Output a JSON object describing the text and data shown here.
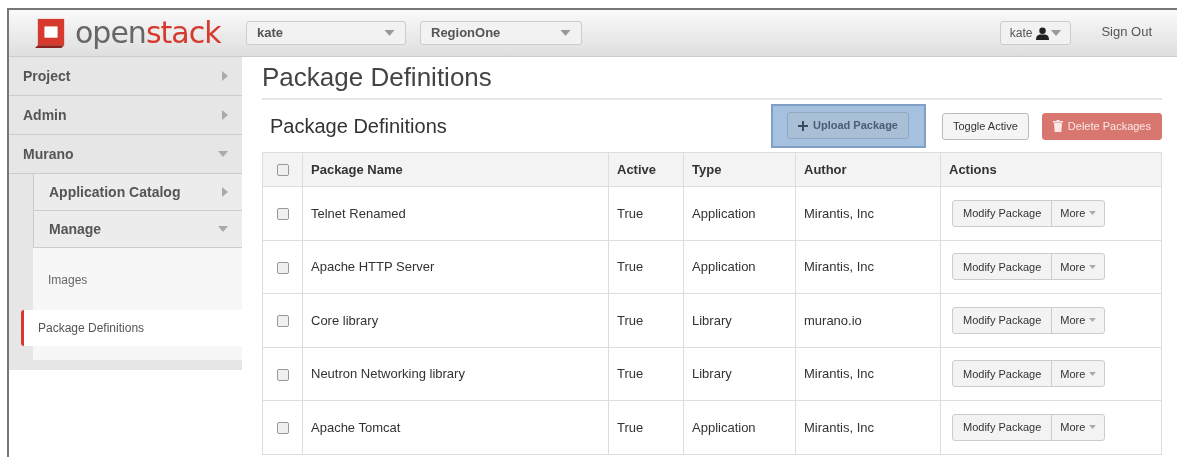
{
  "header": {
    "logo": {
      "prefix": "open",
      "suffix": "stack"
    },
    "project_select": "kate",
    "region_select": "RegionOne",
    "user_menu": "kate",
    "sign_out": "Sign Out"
  },
  "sidebar": {
    "items": [
      {
        "label": "Project",
        "expanded": false
      },
      {
        "label": "Admin",
        "expanded": false
      },
      {
        "label": "Murano",
        "expanded": true,
        "children": [
          {
            "label": "Application Catalog",
            "expanded": false
          },
          {
            "label": "Manage",
            "expanded": true,
            "children": [
              {
                "label": "Images",
                "selected": false
              },
              {
                "label": "Package Definitions",
                "selected": true
              }
            ]
          }
        ]
      }
    ]
  },
  "page_title": "Package Definitions",
  "table_title": "Package Definitions",
  "toolbar": [
    {
      "kind": "upload",
      "label": "Upload Package",
      "highlighted": true
    },
    {
      "kind": "plain",
      "label": "Toggle Active",
      "highlighted": false
    },
    {
      "kind": "danger",
      "label": "Delete Packages",
      "highlighted": false
    }
  ],
  "table": {
    "columns": [
      "Package Name",
      "Active",
      "Type",
      "Author",
      "Actions"
    ],
    "header_checked": false,
    "rows": [
      {
        "checked": false,
        "cells": [
          "Telnet Renamed",
          "True",
          "Application",
          "Mirantis, Inc"
        ],
        "action": "Modify Package",
        "more": "More"
      },
      {
        "checked": false,
        "cells": [
          "Apache HTTP Server",
          "True",
          "Application",
          "Mirantis, Inc"
        ],
        "action": "Modify Package",
        "more": "More"
      },
      {
        "checked": false,
        "cells": [
          "Core library",
          "True",
          "Library",
          "murano.io"
        ],
        "action": "Modify Package",
        "more": "More"
      },
      {
        "checked": false,
        "cells": [
          "Neutron Networking library",
          "True",
          "Library",
          "Mirantis, Inc"
        ],
        "action": "Modify Package",
        "more": "More"
      },
      {
        "checked": false,
        "cells": [
          "Apache Tomcat",
          "True",
          "Application",
          "Mirantis, Inc"
        ],
        "action": "Modify Package",
        "more": "More"
      }
    ]
  }
}
